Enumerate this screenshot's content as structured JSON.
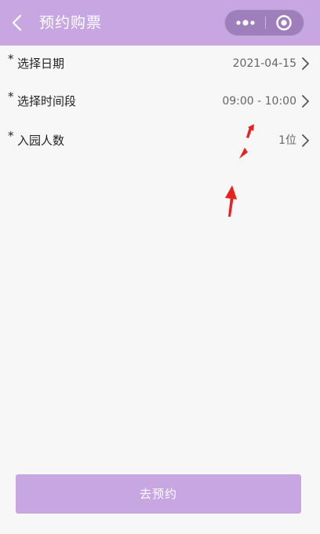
{
  "header": {
    "title": "预约购票",
    "back_icon": "chevron-left-icon",
    "more_icon": "more-dots-icon",
    "close_icon": "target-circle-icon"
  },
  "form": {
    "rows": [
      {
        "required": "*",
        "label": "选择日期",
        "value": "2021-04-15",
        "icon": "chevron-right-icon"
      },
      {
        "required": "*",
        "label": "选择时间段",
        "value": "09:00 - 10:00",
        "icon": "chevron-right-icon"
      },
      {
        "required": "*",
        "label": "入园人数",
        "value": "1位",
        "icon": "chevron-right-icon"
      }
    ]
  },
  "footer": {
    "submit_label": "去预约"
  },
  "colors": {
    "accent": "#c7a6e2",
    "annotation": "#e8231f"
  }
}
